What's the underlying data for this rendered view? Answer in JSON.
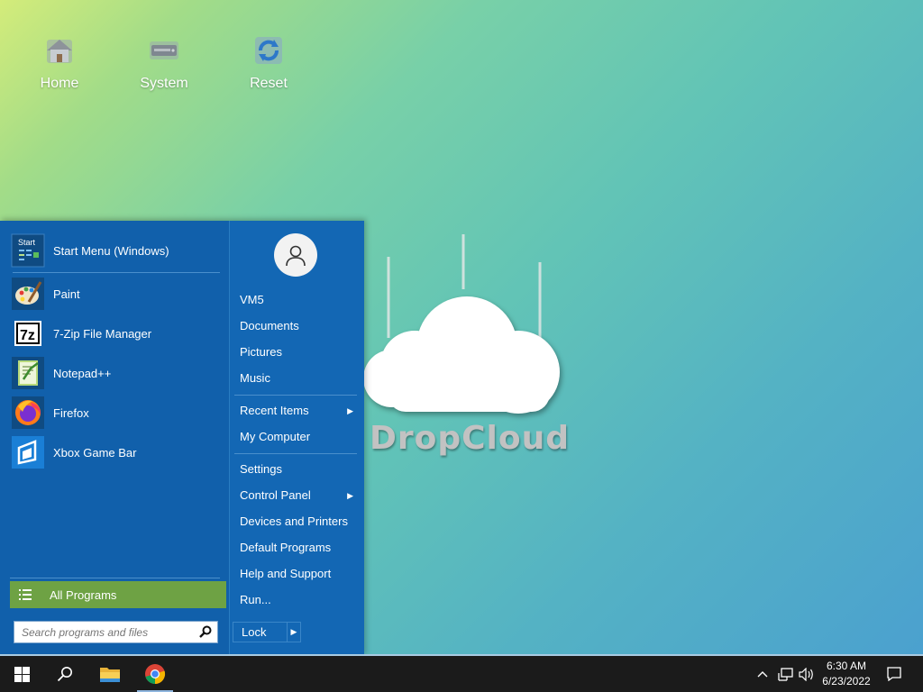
{
  "desktop": {
    "icons": [
      {
        "label": "Home",
        "icon": "home-icon"
      },
      {
        "label": "System",
        "icon": "system-drive-icon"
      },
      {
        "label": "Reset",
        "icon": "reset-icon"
      }
    ],
    "wallpaper_logo_text": "DropCloud"
  },
  "start_menu": {
    "pinned": {
      "label": "Start Menu (Windows)",
      "icon": "start-menu-icon",
      "icon_text": "Start"
    },
    "programs": [
      {
        "label": "Paint",
        "icon": "paint-icon"
      },
      {
        "label": "7-Zip File Manager",
        "icon": "7zip-icon",
        "icon_text": "7z"
      },
      {
        "label": "Notepad++",
        "icon": "notepadpp-icon"
      },
      {
        "label": "Firefox",
        "icon": "firefox-icon"
      },
      {
        "label": "Xbox Game Bar",
        "icon": "xbox-game-bar-icon"
      }
    ],
    "all_programs": "All Programs",
    "search_placeholder": "Search programs and files",
    "right": {
      "user_items": [
        "VM5",
        "Documents",
        "Pictures",
        "Music"
      ],
      "recent_items": "Recent Items",
      "my_computer": "My Computer",
      "settings": "Settings",
      "control_panel": "Control Panel",
      "devices_printers": "Devices and Printers",
      "default_programs": "Default Programs",
      "help_support": "Help and Support",
      "run": "Run...",
      "lock": "Lock"
    }
  },
  "taskbar": {
    "time": "6:30 AM",
    "date": "6/23/2022",
    "apps": [
      "start-button",
      "search-button",
      "file-explorer",
      "chrome"
    ]
  },
  "colors": {
    "start_menu_bg": "#1367b4",
    "all_programs_bg": "#6ea244",
    "taskbar_bg": "#1b1b1b"
  }
}
